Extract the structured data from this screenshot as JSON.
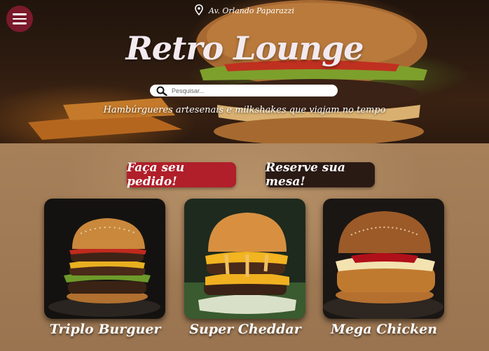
{
  "header": {
    "location": "Av. Orlando Paparazzi",
    "title": "Retro Lounge",
    "tagline": "Hambúrgueres artesenais e milkshakes que viajam no tempo"
  },
  "search": {
    "placeholder": "Pesquisar...",
    "value": ""
  },
  "actions": {
    "order_label": "Faça seu pedido!",
    "reserve_label": "Reserve sua mesa!"
  },
  "products": [
    {
      "name": "Triplo Burguer"
    },
    {
      "name": "Super Cheddar"
    },
    {
      "name": "Mega Chicken"
    }
  ],
  "colors": {
    "menu_button": "#7a1a2a",
    "order_button": "#b01f2a",
    "reserve_button": "#2a1a14",
    "main_background": "#a68059"
  },
  "icons": [
    "menu-icon",
    "location-pin-icon",
    "search-icon"
  ]
}
